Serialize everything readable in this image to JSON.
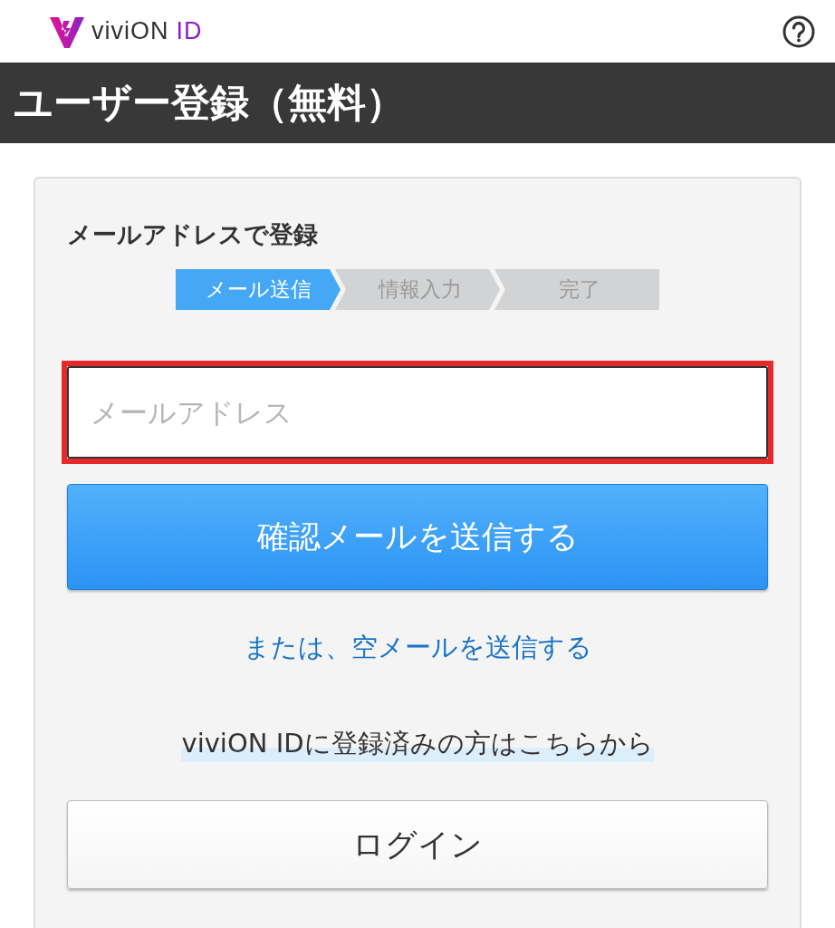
{
  "header": {
    "logo_text": "viviON",
    "logo_suffix": "ID"
  },
  "title_bar": {
    "title": "ユーザー登録（無料）"
  },
  "card": {
    "heading": "メールアドレスで登録",
    "steps": [
      {
        "label": "メール送信",
        "selected": true
      },
      {
        "label": "情報入力",
        "selected": false
      },
      {
        "label": "完了",
        "selected": false
      }
    ],
    "email_field": {
      "placeholder": "メールアドレス",
      "highlighted": true
    },
    "send_button": "確認メールを送信する",
    "empty_mail_link": "または、空メールを送信する",
    "login_note": "viviON IDに登録済みの方はこちらから",
    "login_button": "ログイン"
  }
}
